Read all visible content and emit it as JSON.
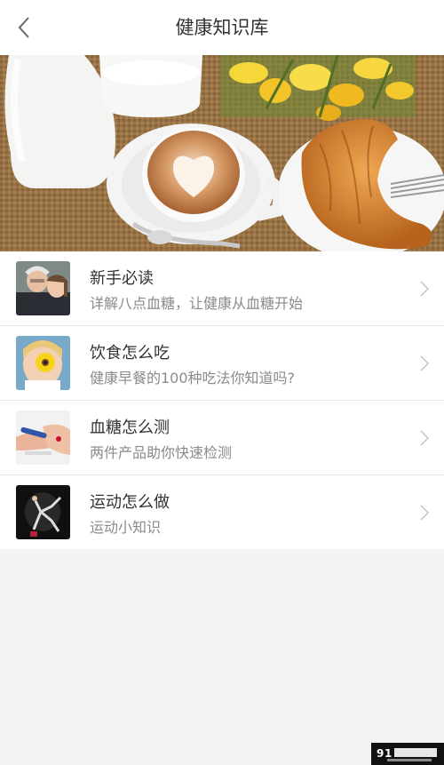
{
  "header": {
    "title": "健康知识库",
    "back_icon": "chevron-left-icon"
  },
  "banner": {
    "description_icon": "coffee-croissant-photo"
  },
  "items": [
    {
      "title": "新手必读",
      "subtitle": "详解八点血糖，让健康从血糖开始",
      "thumb": "elderly-couple-photo"
    },
    {
      "title": "饮食怎么吃",
      "subtitle": "健康早餐的100种吃法你知道吗?",
      "thumb": "child-donut-photo"
    },
    {
      "title": "血糖怎么测",
      "subtitle": "两件产品助你快速检测",
      "thumb": "glucose-test-photo"
    },
    {
      "title": "运动怎么做",
      "subtitle": "运动小知识",
      "thumb": "gymnast-photo"
    }
  ],
  "colors": {
    "background": "#f3f3f3",
    "text_primary": "#333333",
    "text_secondary": "#8a8a8a"
  }
}
